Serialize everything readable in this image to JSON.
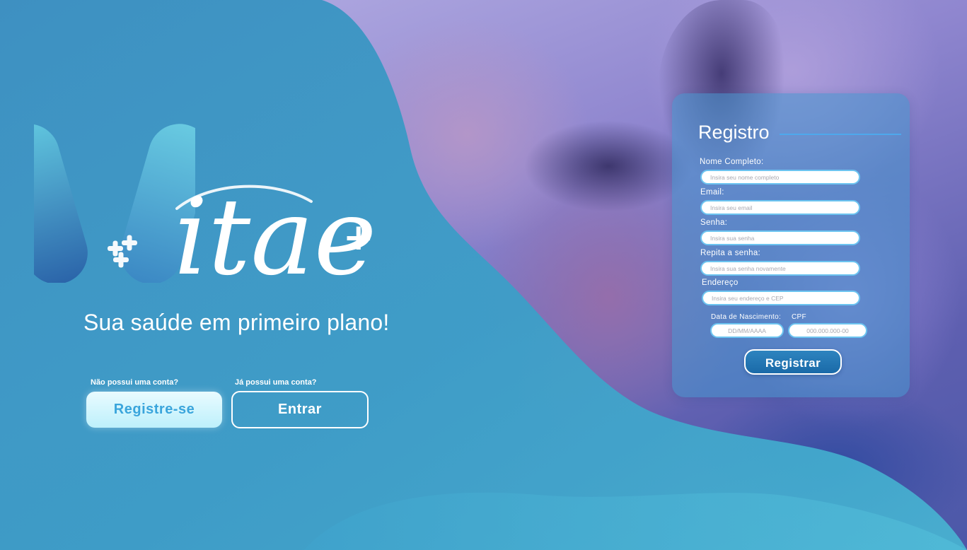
{
  "brand": {
    "logo_letter": "V",
    "logo_word": "itae",
    "logo_plus": "+",
    "tagline": "Sua saúde em primeiro plano!"
  },
  "hero": {
    "no_account_label": "Não possui uma conta?",
    "register_button": "Registre-se",
    "have_account_label": "Já possui uma conta?",
    "login_button": "Entrar"
  },
  "form": {
    "title": "Registro",
    "full_name_label": "Nome Completo:",
    "full_name_placeholder": "Insira seu nome completo",
    "email_label": "Email:",
    "email_placeholder": "Insira seu email",
    "password_label": "Senha:",
    "password_placeholder": "Insira sua senha",
    "repeat_password_label": "Repita a senha:",
    "repeat_password_placeholder": "Insira sua senha novamente",
    "address_label": "Endereço",
    "address_placeholder": "Insira seu endereço e CEP",
    "birthdate_label": "Data de Nascimento:",
    "birthdate_placeholder": "DD/MM/AAAA",
    "cpf_label": "CPF",
    "cpf_placeholder": "000.000.000-00",
    "submit_button": "Registrar"
  },
  "colors": {
    "teal_overlay": "#3aa0c8",
    "button_light": "#bdf0fb",
    "button_text": "#3aa5dc",
    "submit_blue": "#2e84bf",
    "input_border": "#6cc4f0"
  },
  "icons": {
    "logo_cross": "plus-cluster-icon"
  }
}
